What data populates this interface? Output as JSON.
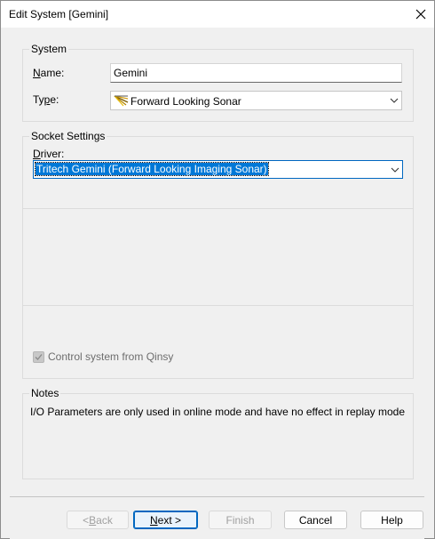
{
  "window": {
    "title": "Edit System [Gemini]"
  },
  "system_group": {
    "legend": "System",
    "name_label_u": "N",
    "name_label_rest": "ame:",
    "name_value": "Gemini",
    "type_label_pre": "Ty",
    "type_label_u": "p",
    "type_label_rest": "e:",
    "type_value": "Forward Looking Sonar",
    "type_icon": "sonar-fan-icon"
  },
  "socket_group": {
    "legend": "Socket Settings",
    "driver_label_u": "D",
    "driver_label_rest": "river:",
    "driver_value": "Tritech Gemini (Forward Looking Imaging Sonar)",
    "control_label": "Control system from Qinsy",
    "control_checked": true
  },
  "notes_group": {
    "legend": "Notes",
    "text": "I/O Parameters are only used in online mode and have no effect in replay mode"
  },
  "buttons": {
    "back_pre": "< ",
    "back_u": "B",
    "back_rest": "ack",
    "next_u": "N",
    "next_rest": "ext >",
    "finish": "Finish",
    "cancel": "Cancel",
    "help": "Help"
  },
  "colors": {
    "accent": "#0067c0",
    "selection": "#0078d7"
  }
}
